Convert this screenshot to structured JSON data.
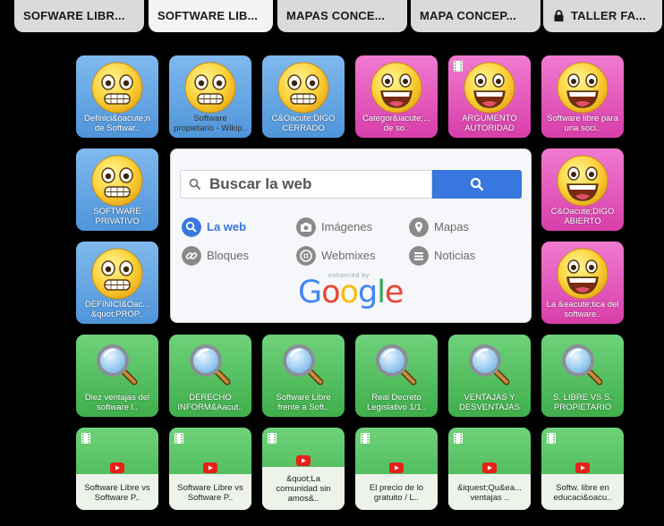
{
  "tabs": [
    {
      "label": "SOFWARE LIBR...",
      "active": false
    },
    {
      "label": "SOFTWARE LIB...",
      "active": true
    },
    {
      "label": "MAPAS CONCE...",
      "active": false
    },
    {
      "label": "MAPA CONCEP...",
      "active": false
    },
    {
      "label": "TALLER FA...",
      "active": false,
      "locked": true
    }
  ],
  "tiles_row1": [
    "Definici&oacute;n de Softwar..",
    "Software propietario - Wikip..",
    "C&Oacute;DIGO CERRADO",
    "Categor&iacute;...  de so..",
    "ARGUMENTO AUTORIDAD",
    "Software libre para una soci.."
  ],
  "tile_r2_left": "SOFTWARE PRIVATIVO",
  "tile_r2_right": "C&Oacute;DIGO ABIERTO",
  "tile_r3_left": "DEFINICI&Oac... &quot;PROP..",
  "tile_r3_right": "La &eacute;tica del software..",
  "search": {
    "placeholder": "Buscar la web",
    "options": [
      {
        "label": "La web",
        "icon": "search-icon"
      },
      {
        "label": "Imágenes",
        "icon": "camera-icon"
      },
      {
        "label": "Mapas",
        "icon": "map-pin-icon"
      },
      {
        "label": "Bloques",
        "icon": "link-icon"
      },
      {
        "label": "Webmixes",
        "icon": "webmix-icon"
      },
      {
        "label": "Noticias",
        "icon": "news-icon"
      }
    ],
    "enhanced_by": "enhanced by",
    "brand": "Google"
  },
  "tiles_row4": [
    "Diez ventajas del software l..",
    "DERECHO INFORM&Aacut..",
    "Software Libre frente a Soft..",
    "Real Decreto Legislativo 1/1..",
    "VENTAJAS Y DESVENTAJAS",
    "S. LIBRE VS S. PROPIETARIO"
  ],
  "tiles_row5": [
    "Software Libre vs Software P..",
    "Software Libre vs Software P..",
    "&quot;La comunidad sin amos&..",
    "El precio de lo gratuito / L..",
    "&iquest;Qu&ea... ventajas ..",
    "Softw. libre en educaci&oacu.."
  ],
  "colors": {
    "blue_tile": "#5fa4e3",
    "pink_tile": "#e24fb7",
    "green_tile": "#52bf5e",
    "google_blue": "#3777df"
  }
}
